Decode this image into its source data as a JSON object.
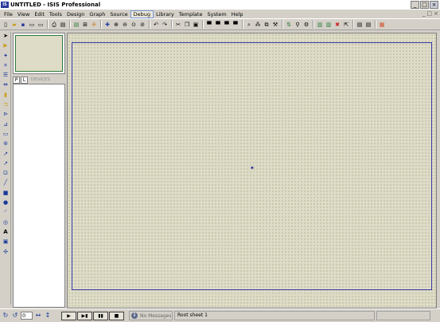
{
  "window": {
    "title": "UNTITLED - ISIS Professional",
    "icon": "isis-app-icon"
  },
  "menus": [
    "File",
    "View",
    "Edit",
    "Tools",
    "Design",
    "Graph",
    "Source",
    "Debug",
    "Library",
    "Template",
    "System",
    "Help"
  ],
  "active_menu": "Debug",
  "device_selector": {
    "pick_label": "P",
    "library_label": "L",
    "header": "DEVICES"
  },
  "status": {
    "angle": "0",
    "message": "No Messages",
    "sheet": "Root sheet 1"
  },
  "colors": {
    "canvas": "#dedcc6",
    "sheet_border": "#3a3aa8",
    "overview_frame": "#2a7a3a"
  }
}
